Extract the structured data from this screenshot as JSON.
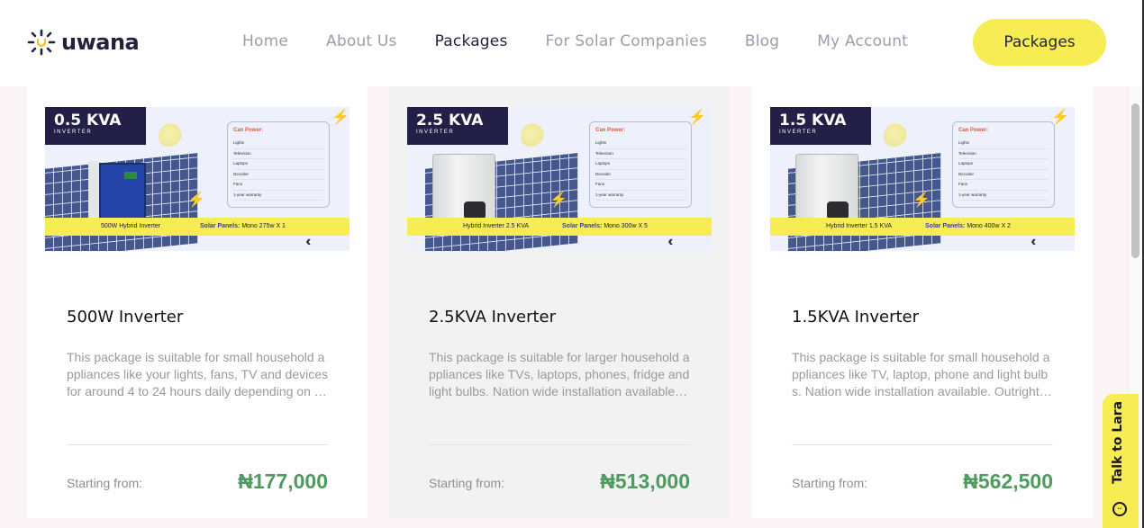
{
  "brand": {
    "name": "uwana"
  },
  "nav": {
    "items": [
      {
        "label": "Home",
        "active": false
      },
      {
        "label": "About Us",
        "active": false
      },
      {
        "label": "Packages",
        "active": true
      },
      {
        "label": "For Solar Companies",
        "active": false
      },
      {
        "label": "Blog",
        "active": false
      },
      {
        "label": "My Account",
        "active": false
      }
    ],
    "cta_label": "Packages"
  },
  "cards": [
    {
      "badge_kva": "0.5 KVA",
      "badge_sub": "INVERTER",
      "can_power_title": "Can Power:",
      "can_power": [
        "Lights",
        "Television",
        "Laptops",
        "Decoder",
        "Fans",
        "1-year warranty"
      ],
      "band_inverter": "500W Hybrid Inverter",
      "band_panels_label": "Solar Panels:",
      "band_panels_value": "Mono 275w X 1",
      "title": "500W Inverter",
      "description": "This package is suitable for small household a ppliances like your lights, fans, TV and devices for around 4 to 24 hours daily depending on …",
      "from_label": "Starting from:",
      "price": "₦177,000"
    },
    {
      "badge_kva": "2.5 KVA",
      "badge_sub": "INVERTER",
      "can_power_title": "Can Power:",
      "can_power": [
        "Lights",
        "Television",
        "Laptops",
        "Decoder",
        "Fans",
        "1-year warranty"
      ],
      "band_inverter": "Hybrid Inverter 2.5 KVA",
      "band_panels_label": "Solar Panels:",
      "band_panels_value": "Mono 300w X 5",
      "title": "2.5KVA Inverter",
      "description": "This package is suitable for larger household a ppliances like TVs, laptops, phones, fridge and light bulbs. Nation wide installation available…",
      "from_label": "Starting from:",
      "price": "₦513,000"
    },
    {
      "badge_kva": "1.5 KVA",
      "badge_sub": "INVERTER",
      "can_power_title": "Can Power:",
      "can_power": [
        "Lights",
        "Television",
        "Laptops",
        "Decoder",
        "Fans",
        "1-year warranty"
      ],
      "band_inverter": "Hybrid Inverter 1.5 KVA",
      "band_panels_label": "Solar Panels:",
      "band_panels_value": "Mono 400w X 2",
      "title": "1.5KVA Inverter",
      "description": "This package is suitable for small household a ppliances like TV, laptop, phone and light bulb s. Nation wide installation available. Outright…",
      "from_label": "Starting from:",
      "price": "₦562,500"
    }
  ],
  "chat": {
    "label": "Talk to Lara",
    "icon": "chat-bubble-icon"
  },
  "colors": {
    "accent_yellow": "#f8ec55",
    "price_green": "#4e9a5f",
    "badge_navy": "#231f46"
  }
}
